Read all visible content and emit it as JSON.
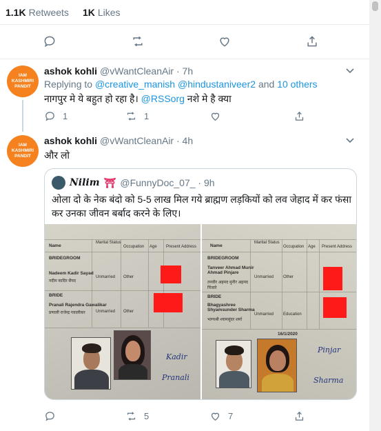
{
  "stats": {
    "retweets_count": "1.1K",
    "retweets_label": "Retweets",
    "likes_count": "1K",
    "likes_label": "Likes"
  },
  "reply1": {
    "avatar_text": [
      "IAM",
      "KASHMIRI",
      "PANDIT"
    ],
    "name": "ashok kohli",
    "handle": "@vWantCleanAir · 7h",
    "replying_prefix": "Replying to",
    "replying_mentions": "@creative_manish @hindustaniveer2",
    "replying_and": "and",
    "replying_others": "10 others",
    "text_before": "नागपुर मे ये बहुत हो रहा है।",
    "text_mention": "@RSSorg",
    "text_after": "नशे मे है क्या",
    "reply_count": "1",
    "retweet_count": "1",
    "like_count": ""
  },
  "reply2": {
    "avatar_text": [
      "IAM",
      "KASHMIRI",
      "PANDIT"
    ],
    "name": "ashok kohli",
    "handle": "@vWantCleanAir · 4h",
    "text": "और लो",
    "retweet_count": "5",
    "like_count": "7"
  },
  "quote": {
    "name": "Nilim",
    "badge": "⛩",
    "handle": "@FunnyDoc_07_ · 9h",
    "text": "ओला दो के नेक बंदो को 5-5 लाख मिल गये ब्राह्मण लड़कियों को लव जेहाद में कर फंसा कर उनका जीवन बर्बाद करने के लिए।",
    "left_form": {
      "heading": "Name",
      "col1": "Marital Status",
      "col2": "Occupation",
      "col3": "Age",
      "col4": "Present Address",
      "bridegroom": "BRIDEGROOM",
      "groom_name": "Nadeem Kadir Sayad",
      "groom_name_hi": "नदीम कादिर सैयद",
      "groom_status": "Unmarried",
      "groom_occ": "Other",
      "bride": "BRIDE",
      "bride_name": "Pranali Rajendra Gawalikar",
      "bride_name_hi": "प्रणाली राजेन्द्र गवालीकर",
      "bride_status": "Unmarried",
      "bride_occ": "Other",
      "sig1": "Kadir",
      "sig2": "Pranali"
    },
    "right_form": {
      "heading": "Name",
      "col1": "Marital Status",
      "col2": "Occupation",
      "col3": "Age",
      "col4": "Present Address",
      "bridegroom": "BRIDEGROOM",
      "groom_name": "Tanveer Ahmad Munir Ahmad Pinjare",
      "groom_name_hi": "तनवीर अहमद मुनीर अहमद पिंजारे",
      "groom_status": "Unmarried",
      "groom_occ": "Other",
      "bride": "BRIDE",
      "bride_name": "Bhagyashree Shyamsunder Sharma",
      "bride_name_hi": "भाग्यश्री श्यामसुंदर शर्मा",
      "bride_status": "Unmarried",
      "bride_occ": "Education",
      "date": "16/1/2020",
      "sig1": "Pinjar",
      "sig2": "Sharma"
    }
  },
  "colors": {
    "accent": "#1b95e0",
    "secondary_text": "#657786",
    "avatar_bg": "#f5821f",
    "redaction": "#ff1a1a"
  }
}
